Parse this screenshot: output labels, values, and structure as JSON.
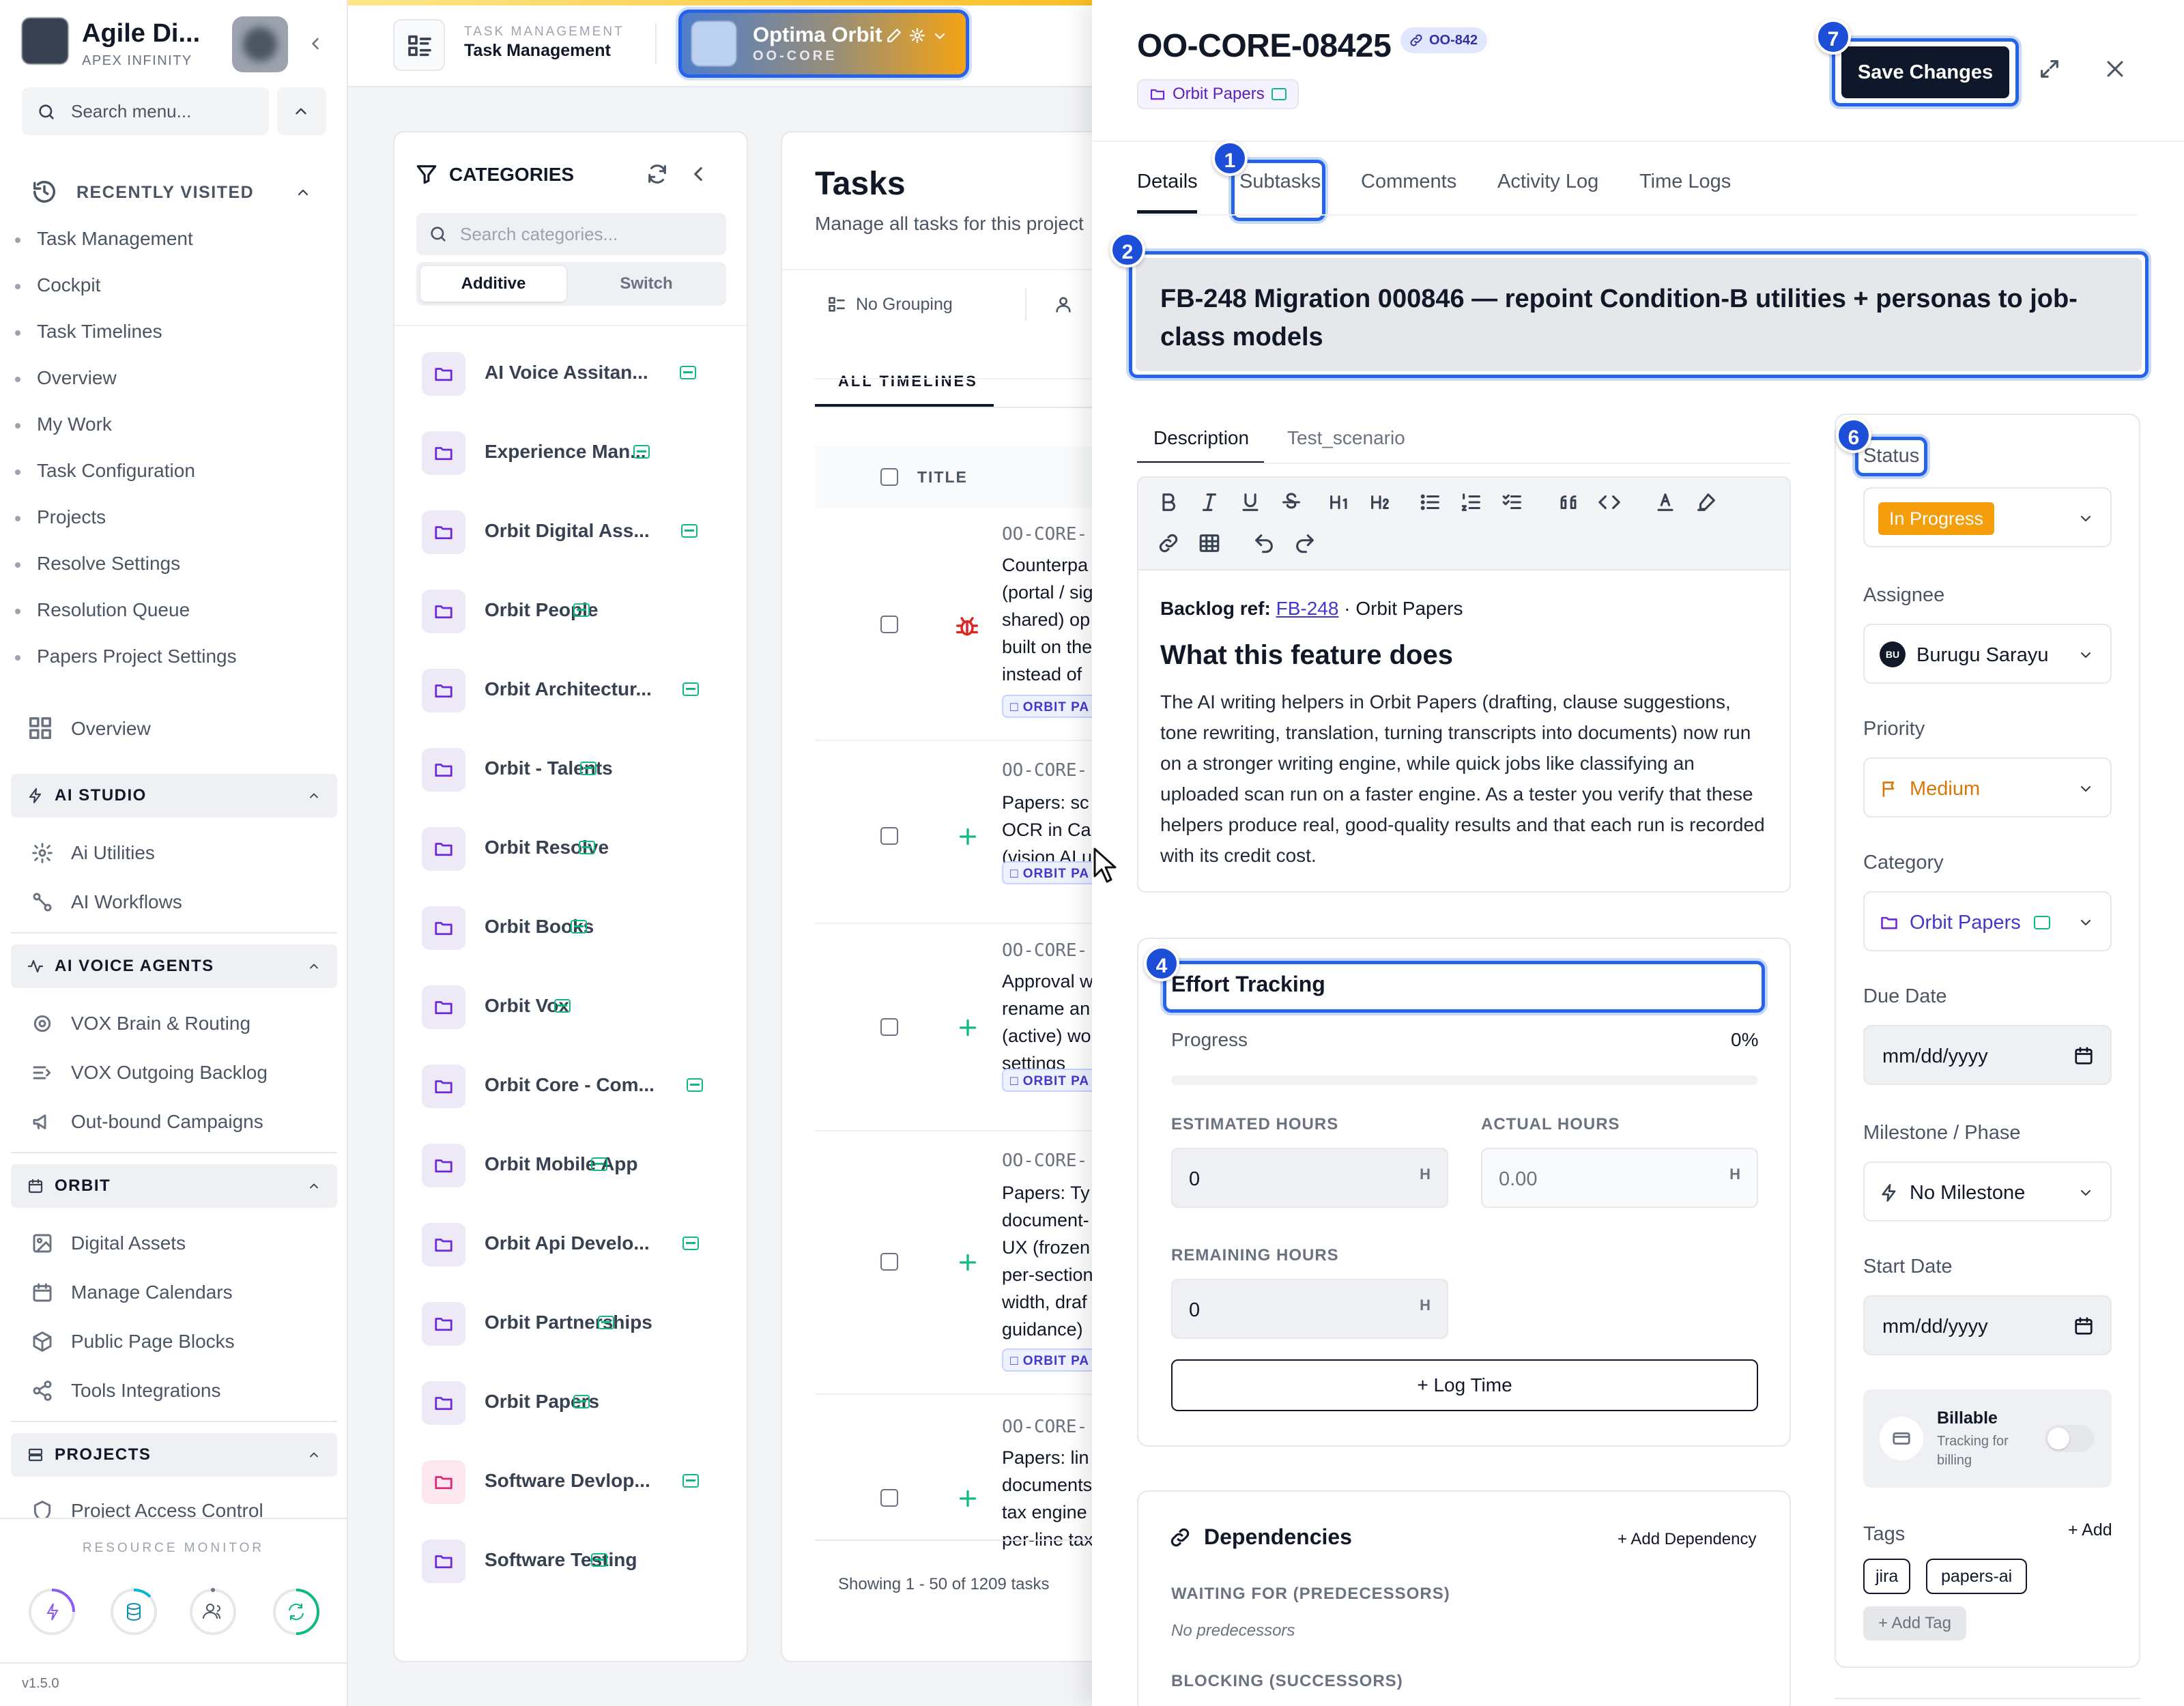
{
  "app": {
    "name": "Agile Di...",
    "subtitle": "APEX INFINITY",
    "version": "v1.5.0"
  },
  "sidebar": {
    "search_placeholder": "Search menu...",
    "recent_title": "RECENTLY VISITED",
    "recent_items": [
      "Task Management",
      "Cockpit",
      "Task Timelines",
      "Overview",
      "My Work",
      "Task Configuration",
      "Projects",
      "Resolve Settings",
      "Resolution Queue",
      "Papers Project Settings"
    ],
    "overview_label": "Overview",
    "ai_studio": {
      "title": "AI STUDIO",
      "items": [
        "Ai Utilities",
        "AI Workflows"
      ]
    },
    "ai_voice": {
      "title": "AI VOICE AGENTS",
      "items": [
        "VOX Brain & Routing",
        "VOX Outgoing Backlog",
        "Out-bound Campaigns"
      ]
    },
    "orbit": {
      "title": "ORBIT",
      "items": [
        "Digital Assets",
        "Manage Calendars",
        "Public Page Blocks",
        "Tools Integrations"
      ]
    },
    "projects": {
      "title": "PROJECTS",
      "items": [
        "Project Access Control"
      ]
    },
    "resource_monitor": "RESOURCE MONITOR"
  },
  "topbar": {
    "section_caps": "TASK MANAGEMENT",
    "section_title": "Task Management",
    "project_name": "Optima Orbit",
    "project_code": "OO-CORE"
  },
  "categories": {
    "title": "CATEGORIES",
    "search_placeholder": "Search categories...",
    "mode_additive": "Additive",
    "mode_switch": "Switch",
    "items": [
      "AI Voice Assitan...",
      "Experience Man...",
      "Orbit Digital Ass...",
      "Orbit People",
      "Orbit Architectur...",
      "Orbit - Talents",
      "Orbit Resolve",
      "Orbit Books",
      "Orbit Vox",
      "Orbit Core - Com...",
      "Orbit Mobile App",
      "Orbit Api Develo...",
      "Orbit Partnerships",
      "Orbit Papers",
      "Software Devlop...",
      "Software Testing"
    ]
  },
  "tasks": {
    "title": "Tasks",
    "subtitle": "Manage all tasks for this project",
    "grouping": "No Grouping",
    "timeline_tab": "ALL TIMELINES",
    "col_title": "TITLE",
    "rows": [
      {
        "id": "OO-CORE-",
        "title": "Counterpa (portal / sig shared) op built on the instead of",
        "chip": "ORBIT PA"
      },
      {
        "id": "OO-CORE-",
        "title": "Papers: sc OCR in Ca (vision AI u",
        "chip": "ORBIT PA"
      },
      {
        "id": "OO-CORE-",
        "title": "Approval w rename an (active) wo settings",
        "chip": "ORBIT PA"
      },
      {
        "id": "OO-CORE-",
        "title": "Papers: Ty document- UX (frozen per-section width, draf guidance)",
        "chip": "ORBIT PA"
      },
      {
        "id": "OO-CORE-",
        "title": "Papers: lin documents tax engine per-line tax",
        "chip": ""
      }
    ],
    "footer": "Showing 1 - 50 of 1209 tasks"
  },
  "detail": {
    "task_id": "OO-CORE-08425",
    "link_badge": "OO-842",
    "category_chip": "Orbit Papers",
    "save_label": "Save Changes",
    "tabs": [
      "Details",
      "Subtasks",
      "Comments",
      "Activity Log",
      "Time Logs"
    ],
    "title": "FB-248 Migration 000846 — repoint Condition-B utilities + personas to job-class models",
    "desc_tabs": [
      "Description",
      "Test_scenario"
    ],
    "backlog_label": "Backlog ref:",
    "backlog_link": "FB-248",
    "backlog_rest": "· Orbit Papers",
    "feature_heading": "What this feature does",
    "feature_body": "The AI writing helpers in Orbit Papers (drafting, clause suggestions, tone rewriting, translation, turning transcripts into documents) now run on a stronger writing engine, while quick jobs like classifying an uploaded scan run on a faster engine. As a tester you verify that these helpers produce real, good-quality results and that each run is recorded with its credit cost.",
    "effort": {
      "title": "Effort Tracking",
      "progress_label": "Progress",
      "progress_value": "0%",
      "progress_fraction": 0,
      "est_label": "ESTIMATED HOURS",
      "est_value": "0",
      "act_label": "ACTUAL HOURS",
      "act_value": "0.00",
      "rem_label": "REMAINING HOURS",
      "rem_value": "0",
      "unit": "H",
      "log_time": "+ Log Time"
    },
    "dependencies": {
      "title": "Dependencies",
      "add": "+ Add Dependency",
      "waiting": "WAITING FOR (PREDECESSORS)",
      "none": "No predecessors",
      "blocking": "BLOCKING (SUCCESSORS)"
    },
    "fields": {
      "status_label": "Status",
      "status_value": "In Progress",
      "assignee_label": "Assignee",
      "assignee_initials": "BU",
      "assignee_value": "Burugu Sarayu",
      "priority_label": "Priority",
      "priority_value": "Medium",
      "category_label": "Category",
      "category_value": "Orbit Papers",
      "due_label": "Due Date",
      "due_placeholder": "mm/dd/yyyy",
      "milestone_label": "Milestone / Phase",
      "milestone_value": "No Milestone",
      "start_label": "Start Date",
      "start_placeholder": "mm/dd/yyyy",
      "billable_title": "Billable",
      "billable_sub": "Tracking for billing",
      "tags_label": "Tags",
      "tags_add": "+ Add",
      "tags": [
        "jira",
        "papers-ai"
      ],
      "add_tag": "+ Add Tag"
    }
  },
  "markers": [
    "1",
    "2",
    "4",
    "6",
    "7"
  ],
  "colors": {
    "accent": "#2563eb",
    "status_orange": "#f59e0b",
    "priority": "#d97706",
    "green": "#10b981",
    "purple": "#6d28d9"
  }
}
